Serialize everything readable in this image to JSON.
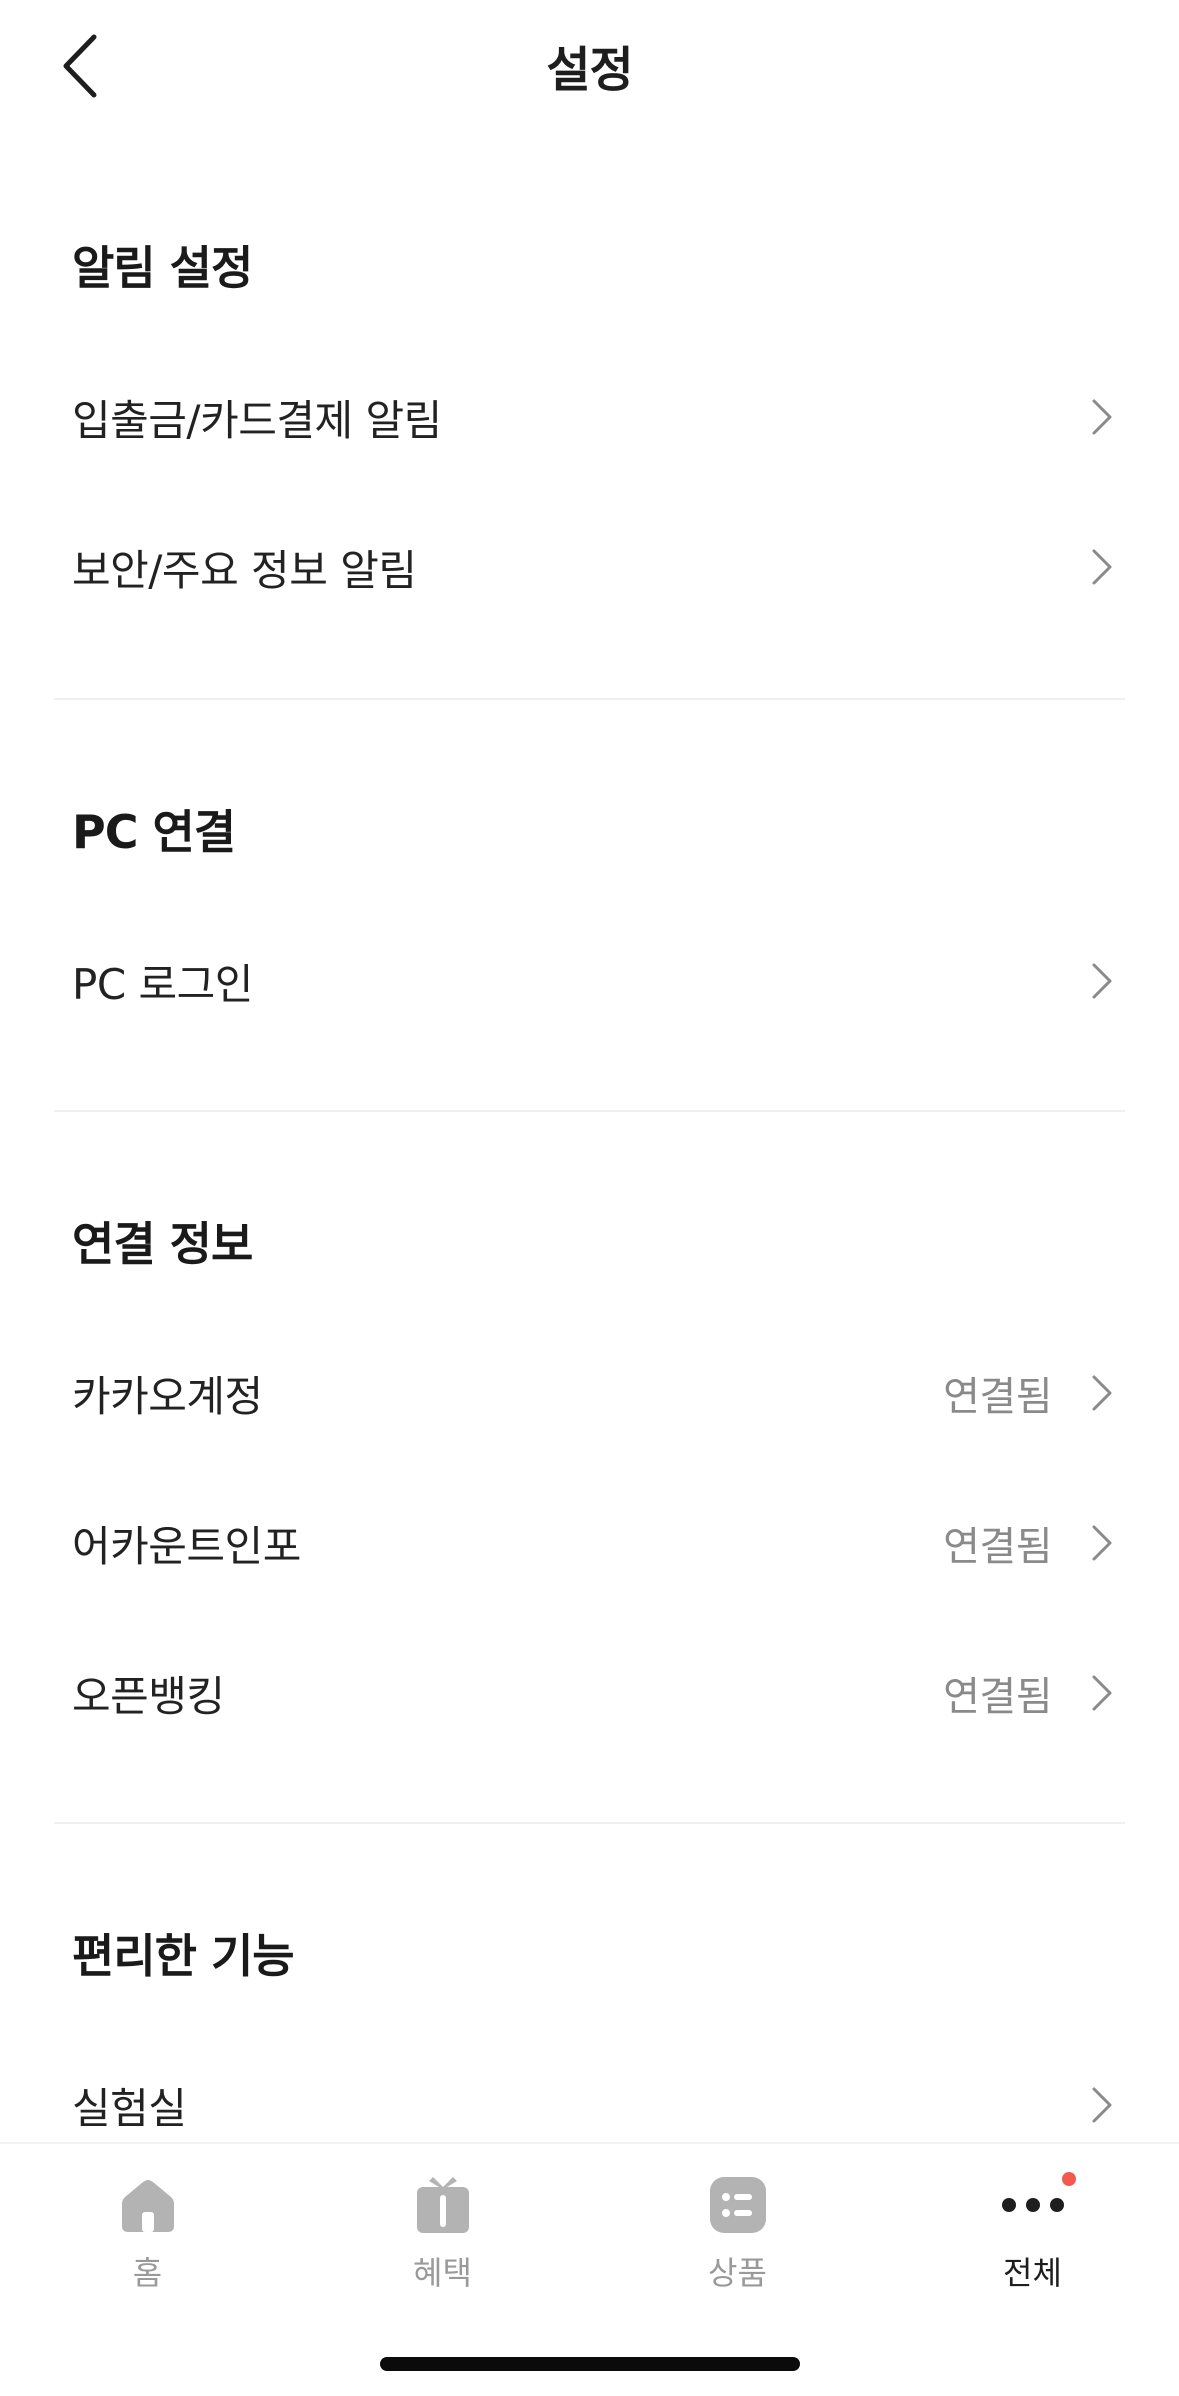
{
  "header": {
    "title": "설정"
  },
  "sections": [
    {
      "title": "알림 설정",
      "items": [
        {
          "label": "입출금/카드결제 알림",
          "value": ""
        },
        {
          "label": "보안/주요 정보 알림",
          "value": ""
        }
      ]
    },
    {
      "title": "PC 연결",
      "items": [
        {
          "label": "PC 로그인",
          "value": ""
        }
      ]
    },
    {
      "title": "연결 정보",
      "items": [
        {
          "label": "카카오계정",
          "value": "연결됨"
        },
        {
          "label": "어카운트인포",
          "value": "연결됨"
        },
        {
          "label": "오픈뱅킹",
          "value": "연결됨"
        }
      ]
    },
    {
      "title": "편리한 기능",
      "items": [
        {
          "label": "실험실",
          "value": ""
        }
      ]
    }
  ],
  "tabbar": {
    "tabs": [
      {
        "label": "홈",
        "icon": "home-icon",
        "active": false
      },
      {
        "label": "혜택",
        "icon": "gift-icon",
        "active": false
      },
      {
        "label": "상품",
        "icon": "list-icon",
        "active": false
      },
      {
        "label": "전체",
        "icon": "more-icon",
        "active": true
      }
    ]
  },
  "colors": {
    "accent_dot": "#f25a4f",
    "inactive": "#9a9a9a",
    "active": "#1e1e1e"
  }
}
